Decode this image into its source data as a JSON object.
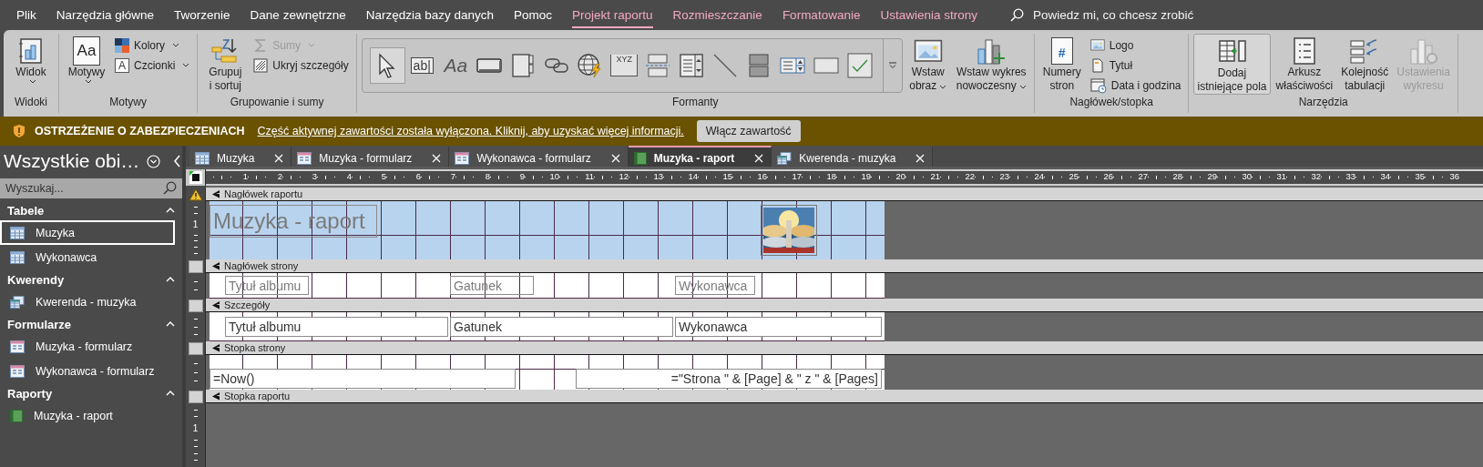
{
  "menu": {
    "tabs": [
      {
        "label": "Plik",
        "selected": false,
        "contextual": false
      },
      {
        "label": "Narzędzia główne",
        "selected": false,
        "contextual": false
      },
      {
        "label": "Tworzenie",
        "selected": false,
        "contextual": false
      },
      {
        "label": "Dane zewnętrzne",
        "selected": false,
        "contextual": false
      },
      {
        "label": "Narzędzia bazy danych",
        "selected": false,
        "contextual": false
      },
      {
        "label": "Pomoc",
        "selected": false,
        "contextual": false
      },
      {
        "label": "Projekt raportu",
        "selected": true,
        "contextual": true
      },
      {
        "label": "Rozmieszczanie",
        "selected": false,
        "contextual": true
      },
      {
        "label": "Formatowanie",
        "selected": false,
        "contextual": true
      },
      {
        "label": "Ustawienia strony",
        "selected": false,
        "contextual": true
      }
    ],
    "search": {
      "placeholder": "Powiedz mi, co chcesz zrobić"
    }
  },
  "ribbon": {
    "groups": [
      {
        "label": "Widoki",
        "items": [
          {
            "label": [
              "Widok"
            ],
            "dropdown": true,
            "disabled": false,
            "pressed": false
          }
        ]
      },
      {
        "label": "Motywy",
        "items": [
          {
            "glyph": "Aa",
            "label": [
              "Motywy"
            ],
            "dropdown": true,
            "disabled": false,
            "pressed": false
          },
          {
            "label": [
              "Kolory"
            ],
            "dropdown": true,
            "disabled": false,
            "pressed": false
          },
          {
            "glyph": "A",
            "label": [
              "Czcionki"
            ],
            "dropdown": true,
            "disabled": false,
            "pressed": false
          }
        ]
      },
      {
        "label": "Grupowanie i sumy",
        "items": [
          {
            "label": [
              "Grupuj",
              "i sortuj"
            ],
            "dropdown": false,
            "disabled": false,
            "pressed": false
          },
          {
            "label": [
              "Sumy"
            ],
            "dropdown": true,
            "disabled": true,
            "pressed": false
          },
          {
            "label": [
              "Ukryj szczegóły"
            ],
            "dropdown": false,
            "disabled": false,
            "pressed": false
          }
        ]
      },
      {
        "label": "Formanty",
        "gallery": [
          {
            "selected": true
          },
          {
            "glyph": "ab|",
            "selected": false
          },
          {
            "glyph": "Aa",
            "selected": false
          },
          {
            "selected": false
          },
          {
            "selected": false
          },
          {
            "selected": false
          },
          {
            "selected": false
          },
          {
            "glyph": "XYZ",
            "selected": false
          },
          {
            "selected": false
          },
          {
            "selected": false
          },
          {
            "selected": false
          },
          {
            "selected": false
          },
          {
            "selected": false
          },
          {
            "selected": false
          },
          {
            "selected": false
          }
        ],
        "items": [
          {
            "label": [
              "Wstaw",
              "obraz"
            ],
            "dropdown": true,
            "disabled": false,
            "pressed": false
          },
          {
            "label": [
              "Wstaw wykres",
              "nowoczesny"
            ],
            "dropdown": true,
            "disabled": false,
            "pressed": false
          }
        ]
      },
      {
        "label": "Nagłówek/stopka",
        "items": [
          {
            "glyph": "#",
            "label": [
              "Numery",
              "stron"
            ],
            "dropdown": false,
            "disabled": false,
            "pressed": false
          },
          {
            "label": [
              "Logo"
            ],
            "dropdown": false,
            "disabled": false,
            "pressed": false
          },
          {
            "label": [
              "Tytuł"
            ],
            "dropdown": false,
            "disabled": false,
            "pressed": false
          },
          {
            "label": [
              "Data i godzina"
            ],
            "dropdown": false,
            "disabled": false,
            "pressed": false
          }
        ]
      },
      {
        "label": "Narzędzia",
        "items": [
          {
            "label": [
              "Dodaj",
              "istniejące pola"
            ],
            "dropdown": false,
            "disabled": false,
            "pressed": true
          },
          {
            "label": [
              "Arkusz",
              "właściwości"
            ],
            "dropdown": false,
            "disabled": false,
            "pressed": false
          },
          {
            "label": [
              "Kolejność",
              "tabulacji"
            ],
            "dropdown": false,
            "disabled": false,
            "pressed": false
          },
          {
            "label": [
              "Ustawienia",
              "wykresu"
            ],
            "dropdown": false,
            "disabled": true,
            "pressed": false
          }
        ]
      }
    ]
  },
  "security_bar": {
    "title": "OSTRZEŻENIE O ZABEZPIECZENIACH",
    "message": "Część aktywnej zawartości została wyłączona. Kliknij, aby uzyskać więcej informacji.",
    "button": "Włącz zawartość"
  },
  "nav": {
    "title": "Wszystkie obi…",
    "search": {
      "placeholder": "Wyszukaj..."
    },
    "groups": [
      {
        "label": "Tabele",
        "expanded": true,
        "items": [
          {
            "label": "Muzyka",
            "kind": "table",
            "selected": true
          },
          {
            "label": "Wykonawca",
            "kind": "table",
            "selected": false
          }
        ]
      },
      {
        "label": "Kwerendy",
        "expanded": true,
        "items": [
          {
            "label": "Kwerenda - muzyka",
            "kind": "query",
            "selected": false
          }
        ]
      },
      {
        "label": "Formularze",
        "expanded": true,
        "items": [
          {
            "label": "Muzyka - formularz",
            "kind": "form",
            "selected": false
          },
          {
            "label": "Wykonawca - formularz",
            "kind": "form",
            "selected": false
          }
        ]
      },
      {
        "label": "Raporty",
        "expanded": true,
        "items": [
          {
            "label": "Muzyka - raport",
            "kind": "report",
            "selected": false
          }
        ]
      }
    ]
  },
  "doc_tabs": [
    {
      "label": "Muzyka",
      "kind": "table",
      "selected": false
    },
    {
      "label": "Muzyka - formularz",
      "kind": "form",
      "selected": false
    },
    {
      "label": "Wykonawca - formularz",
      "kind": "form",
      "selected": false
    },
    {
      "label": "Muzyka - raport",
      "kind": "report",
      "selected": true
    },
    {
      "label": "Kwerenda - muzyka",
      "kind": "query",
      "selected": false
    }
  ],
  "ruler": [
    "1",
    "2",
    "3",
    "4",
    "5",
    "6",
    "7",
    "8",
    "9",
    "10",
    "11",
    "12",
    "13",
    "14",
    "15",
    "16",
    "17",
    "18",
    "19",
    "20",
    "21",
    "22",
    "23",
    "24",
    "25",
    "26",
    "27",
    "28",
    "29",
    "30",
    "31",
    "32",
    "33",
    "34",
    "35",
    "36"
  ],
  "sections": [
    {
      "kind": "report_header",
      "label": "Nagłówek raportu",
      "ruler_label": "1",
      "controls": [
        {
          "kind": "label",
          "text": "Muzyka - raport"
        },
        {
          "kind": "picture"
        }
      ]
    },
    {
      "kind": "page_header",
      "label": "Nagłówek strony",
      "controls": [
        {
          "kind": "label",
          "text": "Tytuł albumu"
        },
        {
          "kind": "label",
          "text": "Gatunek"
        },
        {
          "kind": "label",
          "text": "Wykonawca"
        }
      ]
    },
    {
      "kind": "detail",
      "label": "Szczegóły",
      "controls": [
        {
          "kind": "textbox",
          "text": "Tytuł albumu"
        },
        {
          "kind": "textbox",
          "text": "Gatunek"
        },
        {
          "kind": "textbox",
          "text": "Wykonawca"
        }
      ]
    },
    {
      "kind": "page_footer",
      "label": "Stopka strony",
      "controls": [
        {
          "kind": "textbox",
          "text": "=Now()"
        },
        {
          "kind": "textbox",
          "text": "=\"Strona \" & [Page] & \" z \" & [Pages]"
        }
      ]
    },
    {
      "kind": "report_footer",
      "label": "Stopka raportu",
      "ruler_label": "1"
    }
  ]
}
